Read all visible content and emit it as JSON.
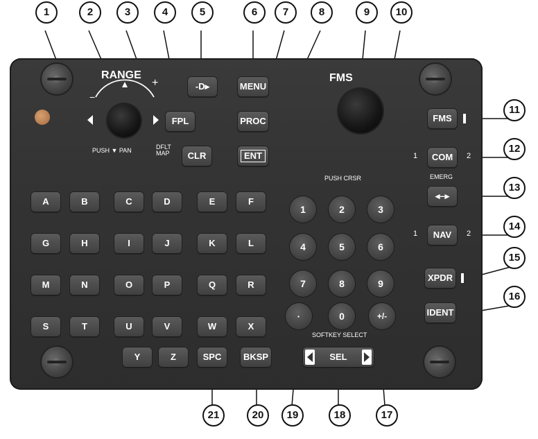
{
  "callouts": [
    "1",
    "2",
    "3",
    "4",
    "5",
    "6",
    "7",
    "8",
    "9",
    "10",
    "11",
    "12",
    "13",
    "14",
    "15",
    "16",
    "17",
    "18",
    "19",
    "20",
    "21"
  ],
  "labels": {
    "range": "RANGE",
    "range_minus": "−",
    "range_plus": "+",
    "push_pan": "PUSH ▼ PAN",
    "dflt_map": "DFLT\nMAP",
    "fms_title": "FMS",
    "push_crsr": "PUSH CRSR",
    "emerg": "EMERG",
    "softkey_select": "SOFTKEY SELECT",
    "com_1": "1",
    "com_2": "2",
    "nav_1": "1",
    "nav_2": "2"
  },
  "keys": {
    "direct_to": "-D▸",
    "menu": "MENU",
    "fpl": "FPL",
    "proc": "PROC",
    "clr": "CLR",
    "ent": "ENT",
    "fms": "FMS",
    "com": "COM",
    "swap": "◂–▸",
    "nav": "NAV",
    "xpdr": "XPDR",
    "ident": "IDENT",
    "spc": "SPC",
    "bksp": "BKSP",
    "sel": "SEL",
    "dot": "·",
    "plus_minus": "+/-"
  },
  "letters": [
    [
      "A",
      "B",
      "C",
      "D",
      "E",
      "F"
    ],
    [
      "G",
      "H",
      "I",
      "J",
      "K",
      "L"
    ],
    [
      "M",
      "N",
      "O",
      "P",
      "Q",
      "R"
    ],
    [
      "S",
      "T",
      "U",
      "V",
      "W",
      "X"
    ],
    [
      "Y",
      "Z"
    ]
  ],
  "numpad": [
    "1",
    "2",
    "3",
    "4",
    "5",
    "6",
    "7",
    "8",
    "9",
    "0"
  ]
}
